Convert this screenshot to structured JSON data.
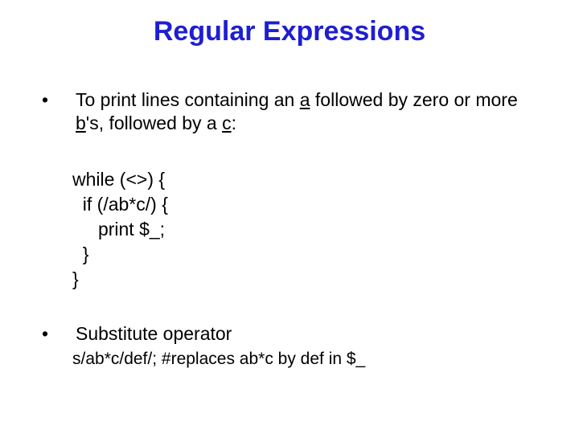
{
  "title": "Regular Expressions",
  "bullet1": {
    "pre_a": "To print lines containing an ",
    "a": "a",
    "mid1": " followed by zero or more ",
    "b": "b",
    "mid2": "'s, followed by a ",
    "c": "c",
    "post": ":"
  },
  "code": {
    "l1": "while (<>) {",
    "l2": "  if (/ab*c/) {",
    "l3": "     print $_;",
    "l4": "  }",
    "l5": "}"
  },
  "bullet2": "Substitute operator",
  "subline": "s/ab*c/def/; #replaces ab*c by def in $_",
  "dot": "•"
}
